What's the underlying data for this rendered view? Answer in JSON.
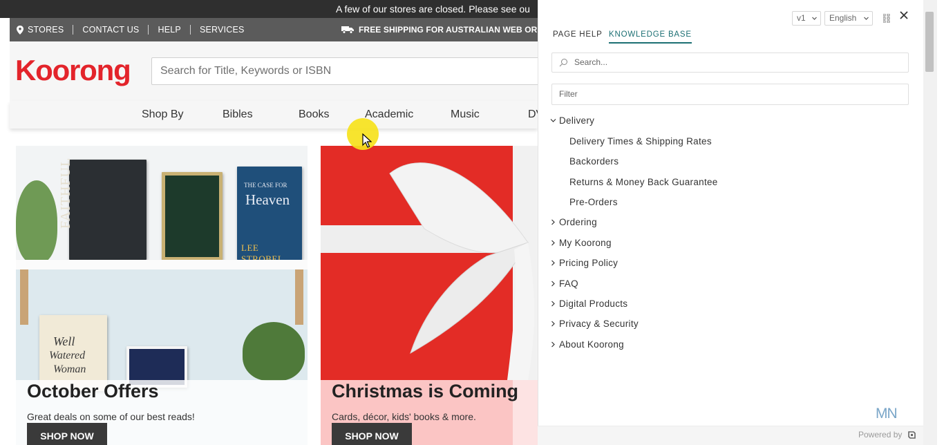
{
  "announcement": "A few of our stores are closed. Please see ou",
  "utility": {
    "stores": "STORES",
    "contact": "CONTACT US",
    "help": "HELP",
    "services": "SERVICES",
    "shipping": "FREE SHIPPING FOR AUSTRALIAN WEB ORDE"
  },
  "header": {
    "logo": "Koorong",
    "search_placeholder": "Search for Title, Keywords or ISBN"
  },
  "nav": [
    "Shop By",
    "Bibles",
    "Books",
    "Academic",
    "Music",
    "DV"
  ],
  "banners": [
    {
      "title": "October Offers",
      "subtitle": "Great deals on some of our best reads!",
      "button": "SHOP NOW"
    },
    {
      "title": "Christmas is Coming",
      "subtitle": "Cards, décor, kids' books & more.",
      "button": "SHOP NOW"
    }
  ],
  "book_covers": {
    "faithful": "FAITHFUL",
    "heaven": "Heaven",
    "heaven_top": "THE CASE FOR",
    "heaven_author": "LEE STROBEL",
    "well_watered_1": "Well",
    "well_watered_2": "Watered",
    "well_watered_3": "Woman"
  },
  "panel": {
    "version": "v1",
    "language": "English",
    "tabs": [
      "PAGE HELP",
      "KNOWLEDGE BASE"
    ],
    "active_tab": "KNOWLEDGE BASE",
    "search_placeholder": "Search...",
    "filter_placeholder": "Filter",
    "expanded": {
      "label": "Delivery",
      "children": [
        "Delivery Times & Shipping Rates",
        "Backorders",
        "Returns & Money Back Guarantee",
        "Pre-Orders"
      ]
    },
    "collapsed": [
      "Ordering",
      "My Koorong",
      "Pricing Policy",
      "FAQ",
      "Digital Products",
      "Privacy & Security",
      "About Koorong"
    ],
    "brand_mark": "MN",
    "powered_by": "Powered by"
  },
  "colors": {
    "brand_red": "#e3242b",
    "tab_active": "#1b6f73",
    "cursor_highlight": "#f6e21c"
  }
}
